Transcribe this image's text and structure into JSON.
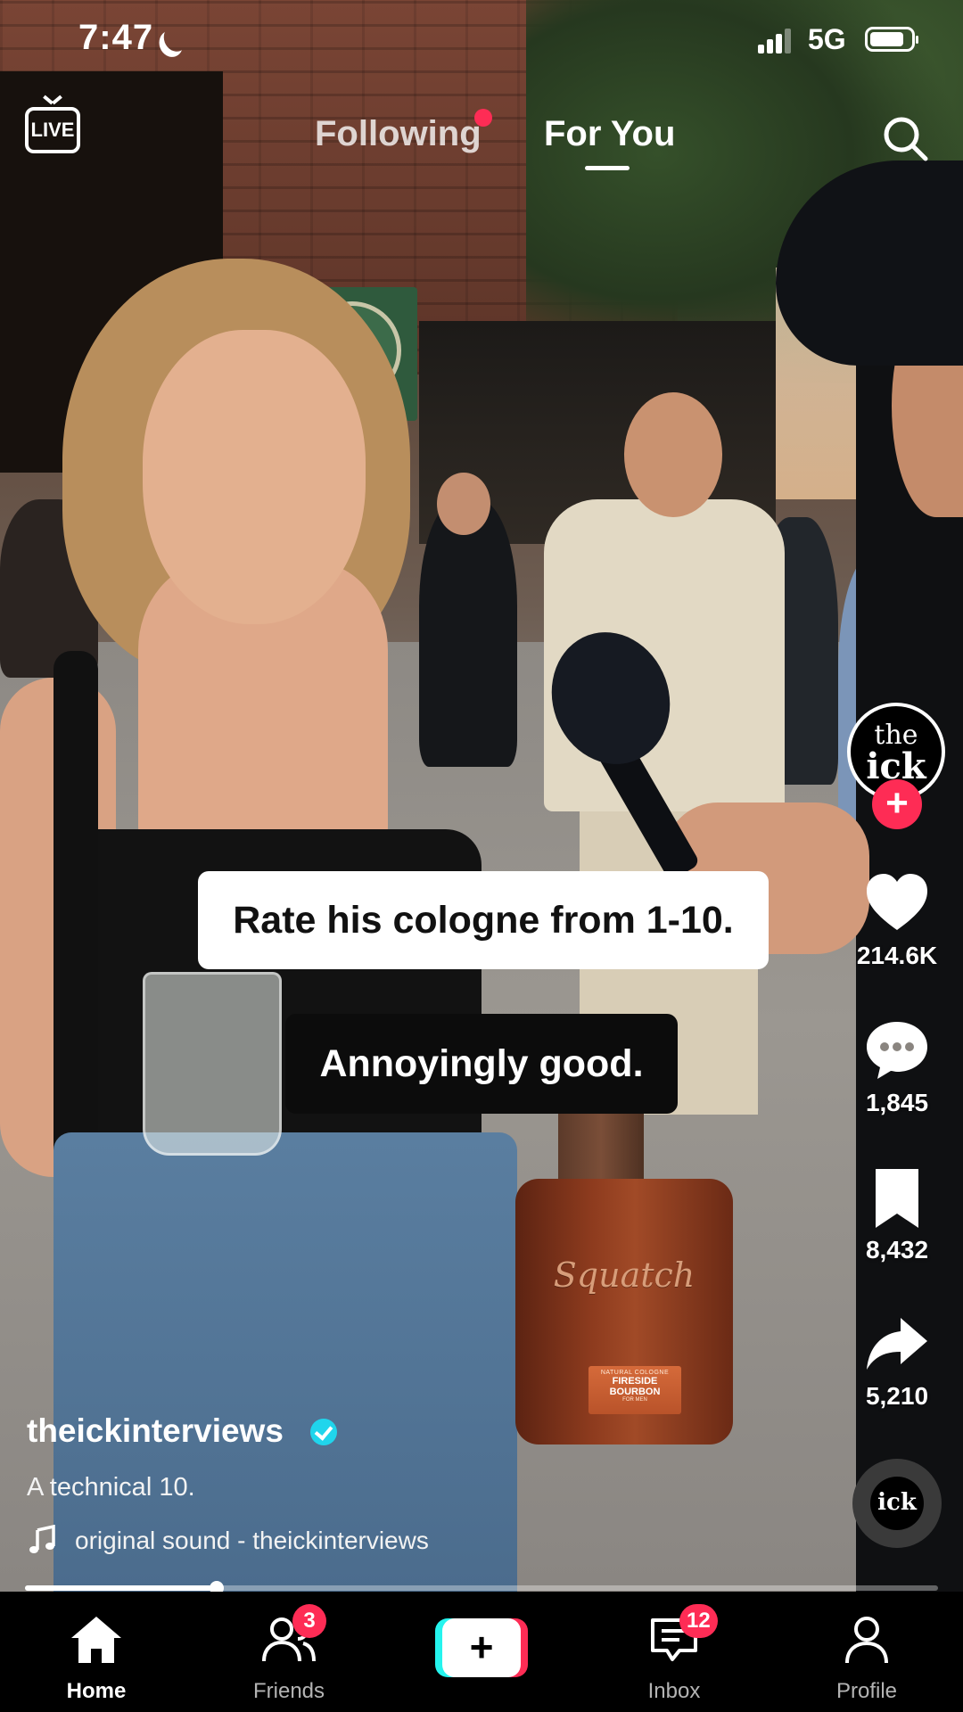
{
  "status_bar": {
    "time": "7:47",
    "network": "5G",
    "battery_level": 0.85,
    "moon_icon": "moon-icon"
  },
  "top_nav": {
    "live_label": "LIVE",
    "tabs": [
      {
        "label": "Following",
        "has_dot": true
      },
      {
        "label": "For You",
        "active": true
      }
    ],
    "search_icon": "search-icon"
  },
  "video": {
    "caption_question": "Rate his cologne from 1-10.",
    "caption_answer": "Annoyingly good.",
    "product": {
      "brand": "Squatch",
      "label_line1": "NATURAL COLOGNE",
      "label_line2": "FIRESIDE BOURBON",
      "label_line3": "FOR MEN"
    },
    "progress": 0.21
  },
  "creator": {
    "avatar_line1": "the",
    "avatar_line2": "ick",
    "username": "theickinterviews",
    "verified": true,
    "description": "A technical 10.",
    "sound": "original sound - theickinterviews",
    "sound_disc_label": "ick"
  },
  "actions": {
    "likes": "214.6K",
    "comments": "1,845",
    "bookmarks": "8,432",
    "shares": "5,210"
  },
  "bottom_nav": {
    "home": "Home",
    "friends": "Friends",
    "friends_badge": "3",
    "create": "+",
    "inbox": "Inbox",
    "inbox_badge": "12",
    "profile": "Profile"
  },
  "colors": {
    "accent": "#fe2c55",
    "cyan": "#25f4ee",
    "verified": "#20d5ec"
  }
}
